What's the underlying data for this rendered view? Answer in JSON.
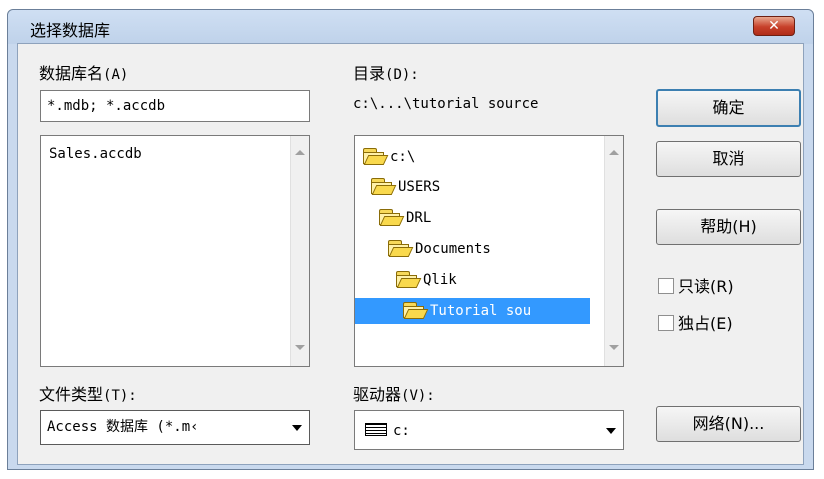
{
  "dialog": {
    "title": "选择数据库",
    "close_label": "✕"
  },
  "db_name": {
    "label_text": "数据库名",
    "label_accel": "(A)",
    "value": "*.mdb; *.accdb",
    "files": [
      "Sales.accdb"
    ]
  },
  "directory": {
    "label_text": "目录",
    "label_accel": "(D):",
    "path": "c:\\...\\tutorial source",
    "items": [
      "c:\\",
      "USERS",
      "DRL",
      "Documents",
      "Qlik",
      "Tutorial sou"
    ],
    "selected_index": 5
  },
  "file_type": {
    "label_text": "文件类型",
    "label_accel": "(T):",
    "value": "Access 数据库 (*.m‹"
  },
  "drive": {
    "label_text": "驱动器",
    "label_accel": "(V):",
    "value": "c:"
  },
  "buttons": {
    "ok": "确定",
    "cancel": "取消",
    "help": "帮助(H)",
    "network": "网络(N)..."
  },
  "options": {
    "readonly": "只读(R)",
    "exclusive": "独占(E)"
  },
  "icons": {
    "folder": "folder-icon",
    "open_folder": "open-folder-icon",
    "drive": "drive-icon"
  }
}
